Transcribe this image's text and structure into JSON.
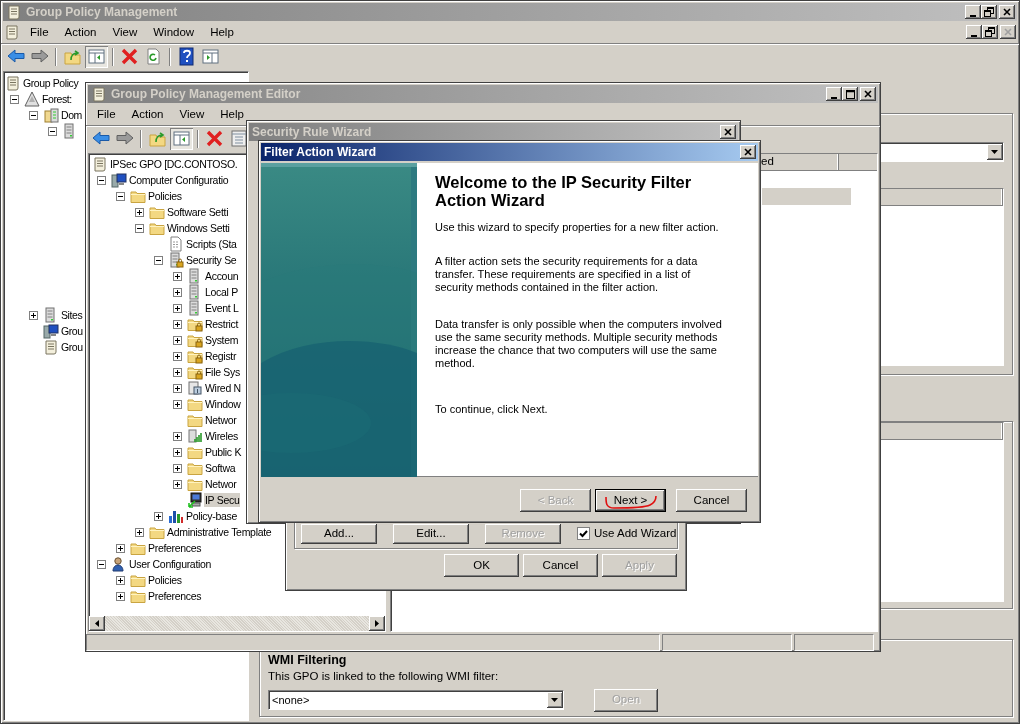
{
  "main_window": {
    "title": "Group Policy Management",
    "menu": [
      "File",
      "Action",
      "View",
      "Window",
      "Help"
    ],
    "tree": [
      {
        "label": "Group Policy",
        "kind": "scroll",
        "children": [
          {
            "label": "Forest:",
            "kind": "forest",
            "expanded": true,
            "children": [
              {
                "label": "Dom",
                "kind": "domain",
                "expanded": true,
                "children": [
                  {
                    "kind": "server",
                    "expanded": true
                  }
                ]
              }
            ]
          }
        ]
      }
    ],
    "tree_lower": [
      {
        "label": "Sites",
        "kind": "server",
        "expanded": false
      },
      {
        "label": "Grou",
        "kind": "computer"
      },
      {
        "label": "Grou",
        "kind": "scroll"
      }
    ],
    "wmi": {
      "heading": "WMI Filtering",
      "text": "This GPO is linked to the following WMI filter:",
      "value": "<none>",
      "button": {
        "label": "Open",
        "disabled": true
      }
    }
  },
  "editor": {
    "title": "Group Policy Management Editor",
    "menu": [
      "File",
      "Action",
      "View",
      "Help"
    ],
    "tree": [
      {
        "label": "IPSec GPO [DC.CONTOSO.",
        "kind": "scroll",
        "selected": false,
        "children": [
          {
            "label": "Computer Configuratio",
            "kind": "computer",
            "expanded": true,
            "selected": false,
            "children": [
              {
                "label": "Policies",
                "kind": "folder",
                "expanded": true,
                "selected": false,
                "children": [
                  {
                    "label": "Software Setti",
                    "kind": "folder",
                    "expanded": false,
                    "selected": false
                  },
                  {
                    "label": "Windows Setti",
                    "kind": "folder",
                    "expanded": true,
                    "selected": false,
                    "children": [
                      {
                        "label": "Scripts (Sta",
                        "kind": "script",
                        "selected": false
                      },
                      {
                        "label": "Security Se",
                        "kind": "secure-server",
                        "expanded": true,
                        "selected": false,
                        "children": [
                          {
                            "label": "Accoun",
                            "kind": "server",
                            "expanded": false,
                            "selected": false
                          },
                          {
                            "label": "Local P",
                            "kind": "server",
                            "expanded": false,
                            "selected": false
                          },
                          {
                            "label": "Event L",
                            "kind": "server",
                            "expanded": false,
                            "selected": false
                          },
                          {
                            "label": "Restrict",
                            "kind": "secure-folder",
                            "expanded": false,
                            "selected": false
                          },
                          {
                            "label": "System",
                            "kind": "secure-folder",
                            "expanded": false,
                            "selected": false
                          },
                          {
                            "label": "Registr",
                            "kind": "secure-folder",
                            "expanded": false,
                            "selected": false
                          },
                          {
                            "label": "File Sys",
                            "kind": "secure-folder",
                            "expanded": false,
                            "selected": false
                          },
                          {
                            "label": "Wired N",
                            "kind": "device",
                            "expanded": false,
                            "selected": false
                          },
                          {
                            "label": "Window",
                            "kind": "folder",
                            "expanded": false,
                            "selected": false
                          },
                          {
                            "label": "Networ",
                            "kind": "folder",
                            "selected": false
                          },
                          {
                            "label": "Wireles",
                            "kind": "wireless",
                            "expanded": false,
                            "selected": false
                          },
                          {
                            "label": "Public K",
                            "kind": "folder",
                            "expanded": false,
                            "selected": false
                          },
                          {
                            "label": "Softwa",
                            "kind": "folder",
                            "expanded": false,
                            "selected": false
                          },
                          {
                            "label": "Networ",
                            "kind": "folder",
                            "expanded": false,
                            "selected": false
                          },
                          {
                            "label": "IP Secu",
                            "kind": "ipsec",
                            "selected": true
                          }
                        ]
                      },
                      {
                        "label": "Policy-base",
                        "kind": "chart",
                        "expanded": false,
                        "selected": false
                      }
                    ]
                  },
                  {
                    "label": "Administrative Template",
                    "kind": "folder",
                    "expanded": false,
                    "selected": false
                  }
                ]
              },
              {
                "label": "Preferences",
                "kind": "folder",
                "expanded": false,
                "selected": false
              }
            ]
          },
          {
            "label": "User Configuration",
            "kind": "user",
            "expanded": true,
            "selected": false,
            "children": [
              {
                "label": "Policies",
                "kind": "folder",
                "expanded": false,
                "selected": false
              },
              {
                "label": "Preferences",
                "kind": "folder",
                "expanded": false,
                "selected": false
              }
            ]
          }
        ]
      }
    ],
    "list_header": "ed"
  },
  "rule_wizard": {
    "title": "Security Rule Wizard"
  },
  "properties_dialog": {
    "buttons": [
      {
        "label": "Add...",
        "disabled": false
      },
      {
        "label": "Edit...",
        "disabled": false
      },
      {
        "label": "Remove",
        "disabled": true
      }
    ],
    "checkbox": {
      "label": "Use Add Wizard",
      "checked": true
    },
    "footer_buttons": [
      {
        "label": "OK",
        "disabled": false
      },
      {
        "label": "Cancel",
        "disabled": false
      },
      {
        "label": "Apply",
        "disabled": true
      }
    ]
  },
  "filter_wizard": {
    "title": "Filter Action Wizard",
    "heading": "Welcome to the IP Security Filter Action Wizard",
    "paragraphs": [
      "Use this wizard to specify properties for a new filter action.",
      "A filter action sets the security requirements for a data transfer. These requirements are specified in a list of security methods contained in the filter action.",
      "Data transfer is only possible when the computers involved use the same security methods. Multiple security methods increase the chance that two computers will use the same method.",
      "To continue, click Next."
    ],
    "buttons": [
      {
        "label": "< Back",
        "disabled": true,
        "default": false
      },
      {
        "label": "Next >",
        "disabled": false,
        "default": true
      },
      {
        "label": "Cancel",
        "disabled": false,
        "default": false
      }
    ]
  }
}
